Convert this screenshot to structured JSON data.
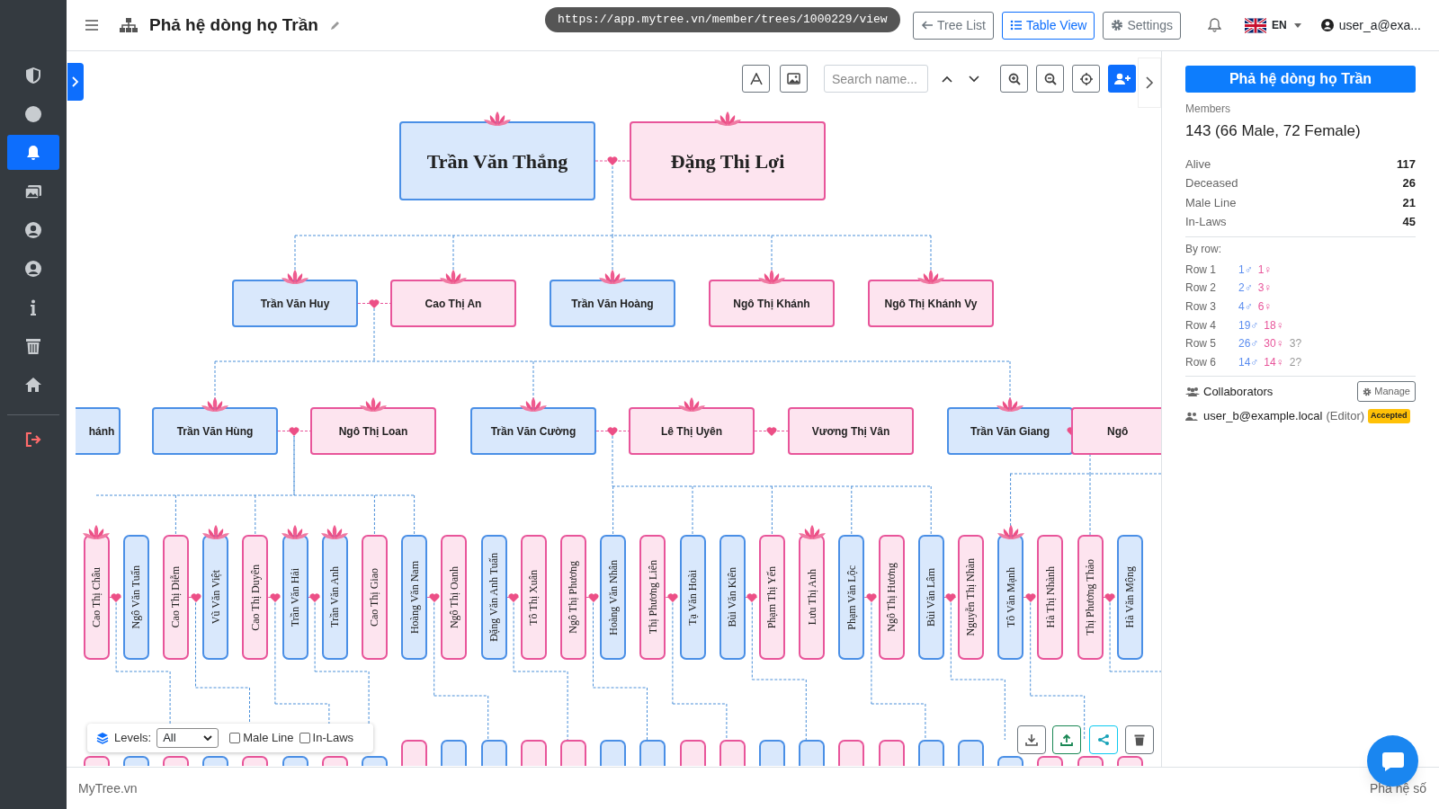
{
  "sidebar": {
    "items": [
      {
        "selected": false
      },
      {
        "selected": false
      },
      {
        "selected": true
      },
      {
        "selected": false
      },
      {
        "selected": false
      },
      {
        "selected": false
      },
      {
        "selected": false
      },
      {
        "selected": false
      },
      {
        "selected": false
      }
    ]
  },
  "header": {
    "title": "Phả hệ dòng họ Trần",
    "url_tooltip": "https://app.mytree.vn/member/trees/1000229/view",
    "buttons": [
      {
        "label": "Tree List",
        "selected": false
      },
      {
        "label": "Table View",
        "selected": true
      },
      {
        "label": "Settings",
        "selected": false
      }
    ],
    "language": "EN",
    "user": "user_a@exa..."
  },
  "toolbar": {
    "search_placeholder": "Search name..."
  },
  "tree": {
    "generations": [
      {
        "units": [
          {
            "kind": "couple",
            "people": [
              {
                "name": "Trần Văn Thắng",
                "kind": "male",
                "lotus": true
              },
              {
                "name": "Đặng Thị Lợi",
                "kind": "female",
                "lotus": true
              }
            ]
          }
        ]
      },
      {
        "units": [
          {
            "kind": "couple",
            "people": [
              {
                "name": "Trần Văn Huy",
                "kind": "male",
                "lotus": true
              },
              {
                "name": "Cao Thị An",
                "kind": "female",
                "lotus": true
              }
            ]
          },
          {
            "kind": "single",
            "people": [
              {
                "name": "Trần Văn Hoàng",
                "kind": "male",
                "lotus": true
              }
            ]
          },
          {
            "kind": "single",
            "people": [
              {
                "name": "Ngô Thị Khánh",
                "kind": "female",
                "lotus": true
              }
            ]
          },
          {
            "kind": "single",
            "people": [
              {
                "name": "Ngô Thị Khánh Vy",
                "kind": "female",
                "lotus": true
              }
            ]
          }
        ]
      },
      {
        "units": [
          {
            "kind": "single",
            "people": [
              {
                "name": "hánh",
                "kind": "male",
                "lotus": false,
                "partial": true
              }
            ]
          },
          {
            "kind": "couple",
            "people": [
              {
                "name": "Trần Văn Hùng",
                "kind": "male",
                "lotus": true,
                "partial": false
              },
              {
                "name": "Ngô Thị Loan",
                "kind": "female",
                "lotus": true,
                "partial": false
              }
            ]
          },
          {
            "kind": "couple",
            "people": [
              {
                "name": "Trần Văn Cường",
                "kind": "male",
                "lotus": true,
                "partial": false
              },
              {
                "name": "Lê Thị Uyên",
                "kind": "female",
                "lotus": true,
                "partial": false
              },
              {
                "name": "Vương Thị Vân",
                "kind": "female",
                "lotus": false,
                "partial": false
              }
            ]
          },
          {
            "kind": "couple",
            "people": [
              {
                "name": "Trần Văn Giang",
                "kind": "male",
                "lotus": true,
                "partial": false
              },
              {
                "name": "Ngô",
                "kind": "female",
                "lotus": false,
                "partial": true
              }
            ]
          }
        ]
      },
      {
        "units": [
          {
            "kind": "couple",
            "people": [
              {
                "name": "Cao Thị Châu",
                "kind": "female",
                "lotus": true
              },
              {
                "name": "Ngô Văn Tuấn",
                "kind": "male",
                "lotus": false
              }
            ]
          },
          {
            "kind": "couple",
            "people": [
              {
                "name": "Cao Thị Diễm",
                "kind": "female",
                "lotus": false
              },
              {
                "name": "Vũ Văn Việt",
                "kind": "male",
                "lotus": true
              }
            ]
          },
          {
            "kind": "couple",
            "people": [
              {
                "name": "Cao Thị Duyên",
                "kind": "female",
                "lotus": false
              },
              {
                "name": "Trần Văn Hải",
                "kind": "male",
                "lotus": true
              },
              {
                "name": "Trần Văn Anh",
                "kind": "male",
                "lotus": true
              }
            ]
          },
          {
            "kind": "single",
            "people": [
              {
                "name": "Cao Thị Giao",
                "kind": "female",
                "lotus": false
              }
            ]
          },
          {
            "kind": "couple",
            "people": [
              {
                "name": "Hoàng Văn Nam",
                "kind": "male",
                "lotus": false
              },
              {
                "name": "Ngô Thị Oanh",
                "kind": "female",
                "lotus": false
              }
            ]
          },
          {
            "kind": "couple",
            "people": [
              {
                "name": "Đặng Văn Anh Tuấn",
                "kind": "male",
                "lotus": false
              },
              {
                "name": "Tô Thị Xuân",
                "kind": "female",
                "lotus": false
              }
            ]
          },
          {
            "kind": "couple",
            "people": [
              {
                "name": "Ngô Thị Phương",
                "kind": "female",
                "lotus": false
              },
              {
                "name": "Hoàng Văn Nhân",
                "kind": "male",
                "lotus": false
              }
            ]
          },
          {
            "kind": "couple",
            "people": [
              {
                "name": "Thị Phương Liên",
                "kind": "female",
                "lotus": false
              },
              {
                "name": "Tạ Văn Hoài",
                "kind": "male",
                "lotus": false
              }
            ]
          },
          {
            "kind": "couple",
            "people": [
              {
                "name": "Bùi Văn Kiên",
                "kind": "male",
                "lotus": false
              },
              {
                "name": "Phạm Thị Yến",
                "kind": "female",
                "lotus": false
              }
            ]
          },
          {
            "kind": "single",
            "people": [
              {
                "name": "Lưu Thị Anh",
                "kind": "female",
                "lotus": true
              }
            ]
          },
          {
            "kind": "couple",
            "people": [
              {
                "name": "Phạm Văn Lộc",
                "kind": "male",
                "lotus": false
              },
              {
                "name": "Ngô Thị Hương",
                "kind": "female",
                "lotus": false
              }
            ]
          },
          {
            "kind": "couple",
            "people": [
              {
                "name": "Bùi Văn Lâm",
                "kind": "male",
                "lotus": false
              },
              {
                "name": "Nguyễn Thị Nhàn",
                "kind": "female",
                "lotus": false
              }
            ]
          },
          {
            "kind": "couple",
            "people": [
              {
                "name": "Tô Văn Mạnh",
                "kind": "male",
                "lotus": true
              },
              {
                "name": "Hà Thị Nhành",
                "kind": "female",
                "lotus": false
              }
            ]
          },
          {
            "kind": "couple",
            "people": [
              {
                "name": "Thị Phương Thảo",
                "kind": "female",
                "lotus": false
              },
              {
                "name": "Hà Văn Mộng",
                "kind": "male",
                "lotus": false
              }
            ]
          }
        ]
      }
    ],
    "bottom_cards": [
      {
        "kind": "female"
      },
      {
        "kind": "male"
      },
      {
        "kind": "female"
      },
      {
        "kind": "male"
      },
      {
        "kind": "female"
      },
      {
        "kind": "male"
      },
      {
        "kind": "female"
      },
      {
        "kind": "male"
      },
      {
        "kind": "female"
      },
      {
        "kind": "male"
      },
      {
        "kind": "male"
      },
      {
        "kind": "female"
      },
      {
        "kind": "female"
      },
      {
        "kind": "male"
      },
      {
        "kind": "male"
      },
      {
        "kind": "female"
      },
      {
        "kind": "female"
      },
      {
        "kind": "male"
      },
      {
        "kind": "male"
      },
      {
        "kind": "female"
      },
      {
        "kind": "female"
      },
      {
        "kind": "male"
      },
      {
        "kind": "male"
      },
      {
        "kind": "male"
      },
      {
        "kind": "female"
      },
      {
        "kind": "female"
      },
      {
        "kind": "female"
      }
    ]
  },
  "levels_panel": {
    "label": "Levels:",
    "select": "All",
    "checkboxes": [
      {
        "label": "Male Line",
        "checked": false
      },
      {
        "label": "In-Laws",
        "checked": false
      }
    ]
  },
  "info_panel": {
    "title": "Phả hệ dòng họ Trần",
    "members_label": "Members",
    "members": "143 (66 Male, 72 Female)",
    "stats": [
      {
        "label": "Alive",
        "value": "117"
      },
      {
        "label": "Deceased",
        "value": "26"
      },
      {
        "label": "Male Line",
        "value": "21"
      },
      {
        "label": "In-Laws",
        "value": "45"
      }
    ],
    "by_row_label": "By row:",
    "rows": [
      {
        "label": "Row 1",
        "male": "1♂",
        "female": "1♀"
      },
      {
        "label": "Row 2",
        "male": "2♂",
        "female": "3♀"
      },
      {
        "label": "Row 3",
        "male": "4♂",
        "female": "6♀"
      },
      {
        "label": "Row 4",
        "male": "19♂",
        "female": "18♀"
      },
      {
        "label": "Row 5",
        "male": "26♂",
        "female": "30♀",
        "unknown": "3?"
      },
      {
        "label": "Row 6",
        "male": "14♂",
        "female": "14♀",
        "unknown": "2?"
      }
    ],
    "collaborators_label": "Collaborators",
    "manage_button": "Manage",
    "collaborators": [
      {
        "email": "user_b@example.local",
        "role": "(Editor)",
        "status": "Accepted"
      }
    ]
  },
  "footer": {
    "brand": "MyTree.vn",
    "right": "Phả hệ số"
  }
}
